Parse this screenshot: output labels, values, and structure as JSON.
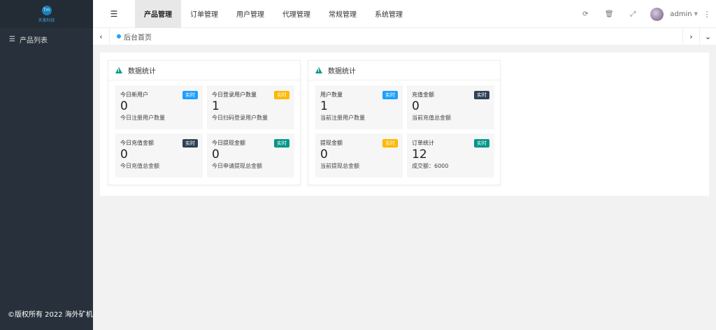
{
  "sidebar": {
    "logo_text": "天美科技",
    "items": [
      {
        "label": "产品列表",
        "icon": "list-icon"
      }
    ],
    "copyright": "©版权所有 2022 海外矿机"
  },
  "topbar": {
    "nav": [
      "产品管理",
      "订单管理",
      "用户管理",
      "代理管理",
      "常规管理",
      "系统管理"
    ],
    "active_index": 0,
    "user": "admin"
  },
  "tabbar": {
    "home_label": "后台首页"
  },
  "badge_colors": {
    "blue": "#1e9fff",
    "orange": "#ffb800",
    "dark": "#2f4056",
    "teal": "#009688"
  },
  "panels": [
    {
      "title": "数据统计",
      "cards": [
        {
          "title": "今日新用户",
          "badge": "实时",
          "badge_color": "#1e9fff",
          "value": "0",
          "desc": "今日注册用户数量"
        },
        {
          "title": "今日登录用户数量",
          "badge": "实时",
          "badge_color": "#ffb800",
          "value": "1",
          "desc": "今日扫码登录用户数量"
        },
        {
          "title": "今日充值金额",
          "badge": "实时",
          "badge_color": "#2f4056",
          "value": "0",
          "desc": "今日充值总金额"
        },
        {
          "title": "今日提现金额",
          "badge": "实时",
          "badge_color": "#009688",
          "value": "0",
          "desc": "今日申请提现总金额"
        }
      ]
    },
    {
      "title": "数据统计",
      "cards": [
        {
          "title": "用户数量",
          "badge": "实时",
          "badge_color": "#1e9fff",
          "value": "1",
          "desc": "当前注册用户数量"
        },
        {
          "title": "充值金额",
          "badge": "实时",
          "badge_color": "#2f4056",
          "value": "0",
          "desc": "当前充值总金额"
        },
        {
          "title": "提现金额",
          "badge": "实时",
          "badge_color": "#ffb800",
          "value": "0",
          "desc": "当前提现总金额"
        },
        {
          "title": "订单统计",
          "badge": "实时",
          "badge_color": "#009688",
          "value": "12",
          "desc": "成交额：6000"
        }
      ]
    }
  ]
}
